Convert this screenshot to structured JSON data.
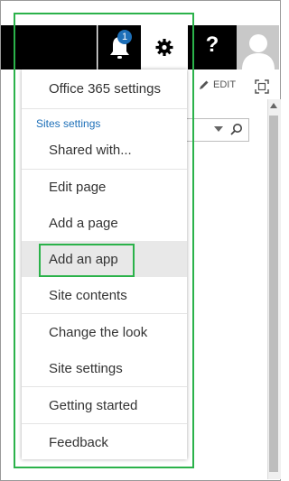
{
  "header": {
    "notification_count": "1",
    "help_label": "?"
  },
  "toolbar": {
    "edit_label": "EDIT"
  },
  "settings_menu": {
    "items": [
      {
        "label": "Office 365 settings"
      },
      {
        "label": "Sites settings"
      },
      {
        "label": "Shared with..."
      },
      {
        "label": "Edit page"
      },
      {
        "label": "Add a page"
      },
      {
        "label": "Add an app"
      },
      {
        "label": "Site contents"
      },
      {
        "label": "Change the look"
      },
      {
        "label": "Site settings"
      },
      {
        "label": "Getting started"
      },
      {
        "label": "Feedback"
      }
    ],
    "highlighted_item": "Add an app"
  },
  "colors": {
    "accent": "#1d6fb8",
    "annotation": "#2bb24a",
    "topbar": "#000000",
    "hover": "#e8e8e8"
  },
  "icons": [
    "bell-icon",
    "gear-icon",
    "help-icon",
    "avatar-icon",
    "pencil-icon",
    "focus-icon",
    "caret-icon",
    "magnifier-icon"
  ]
}
